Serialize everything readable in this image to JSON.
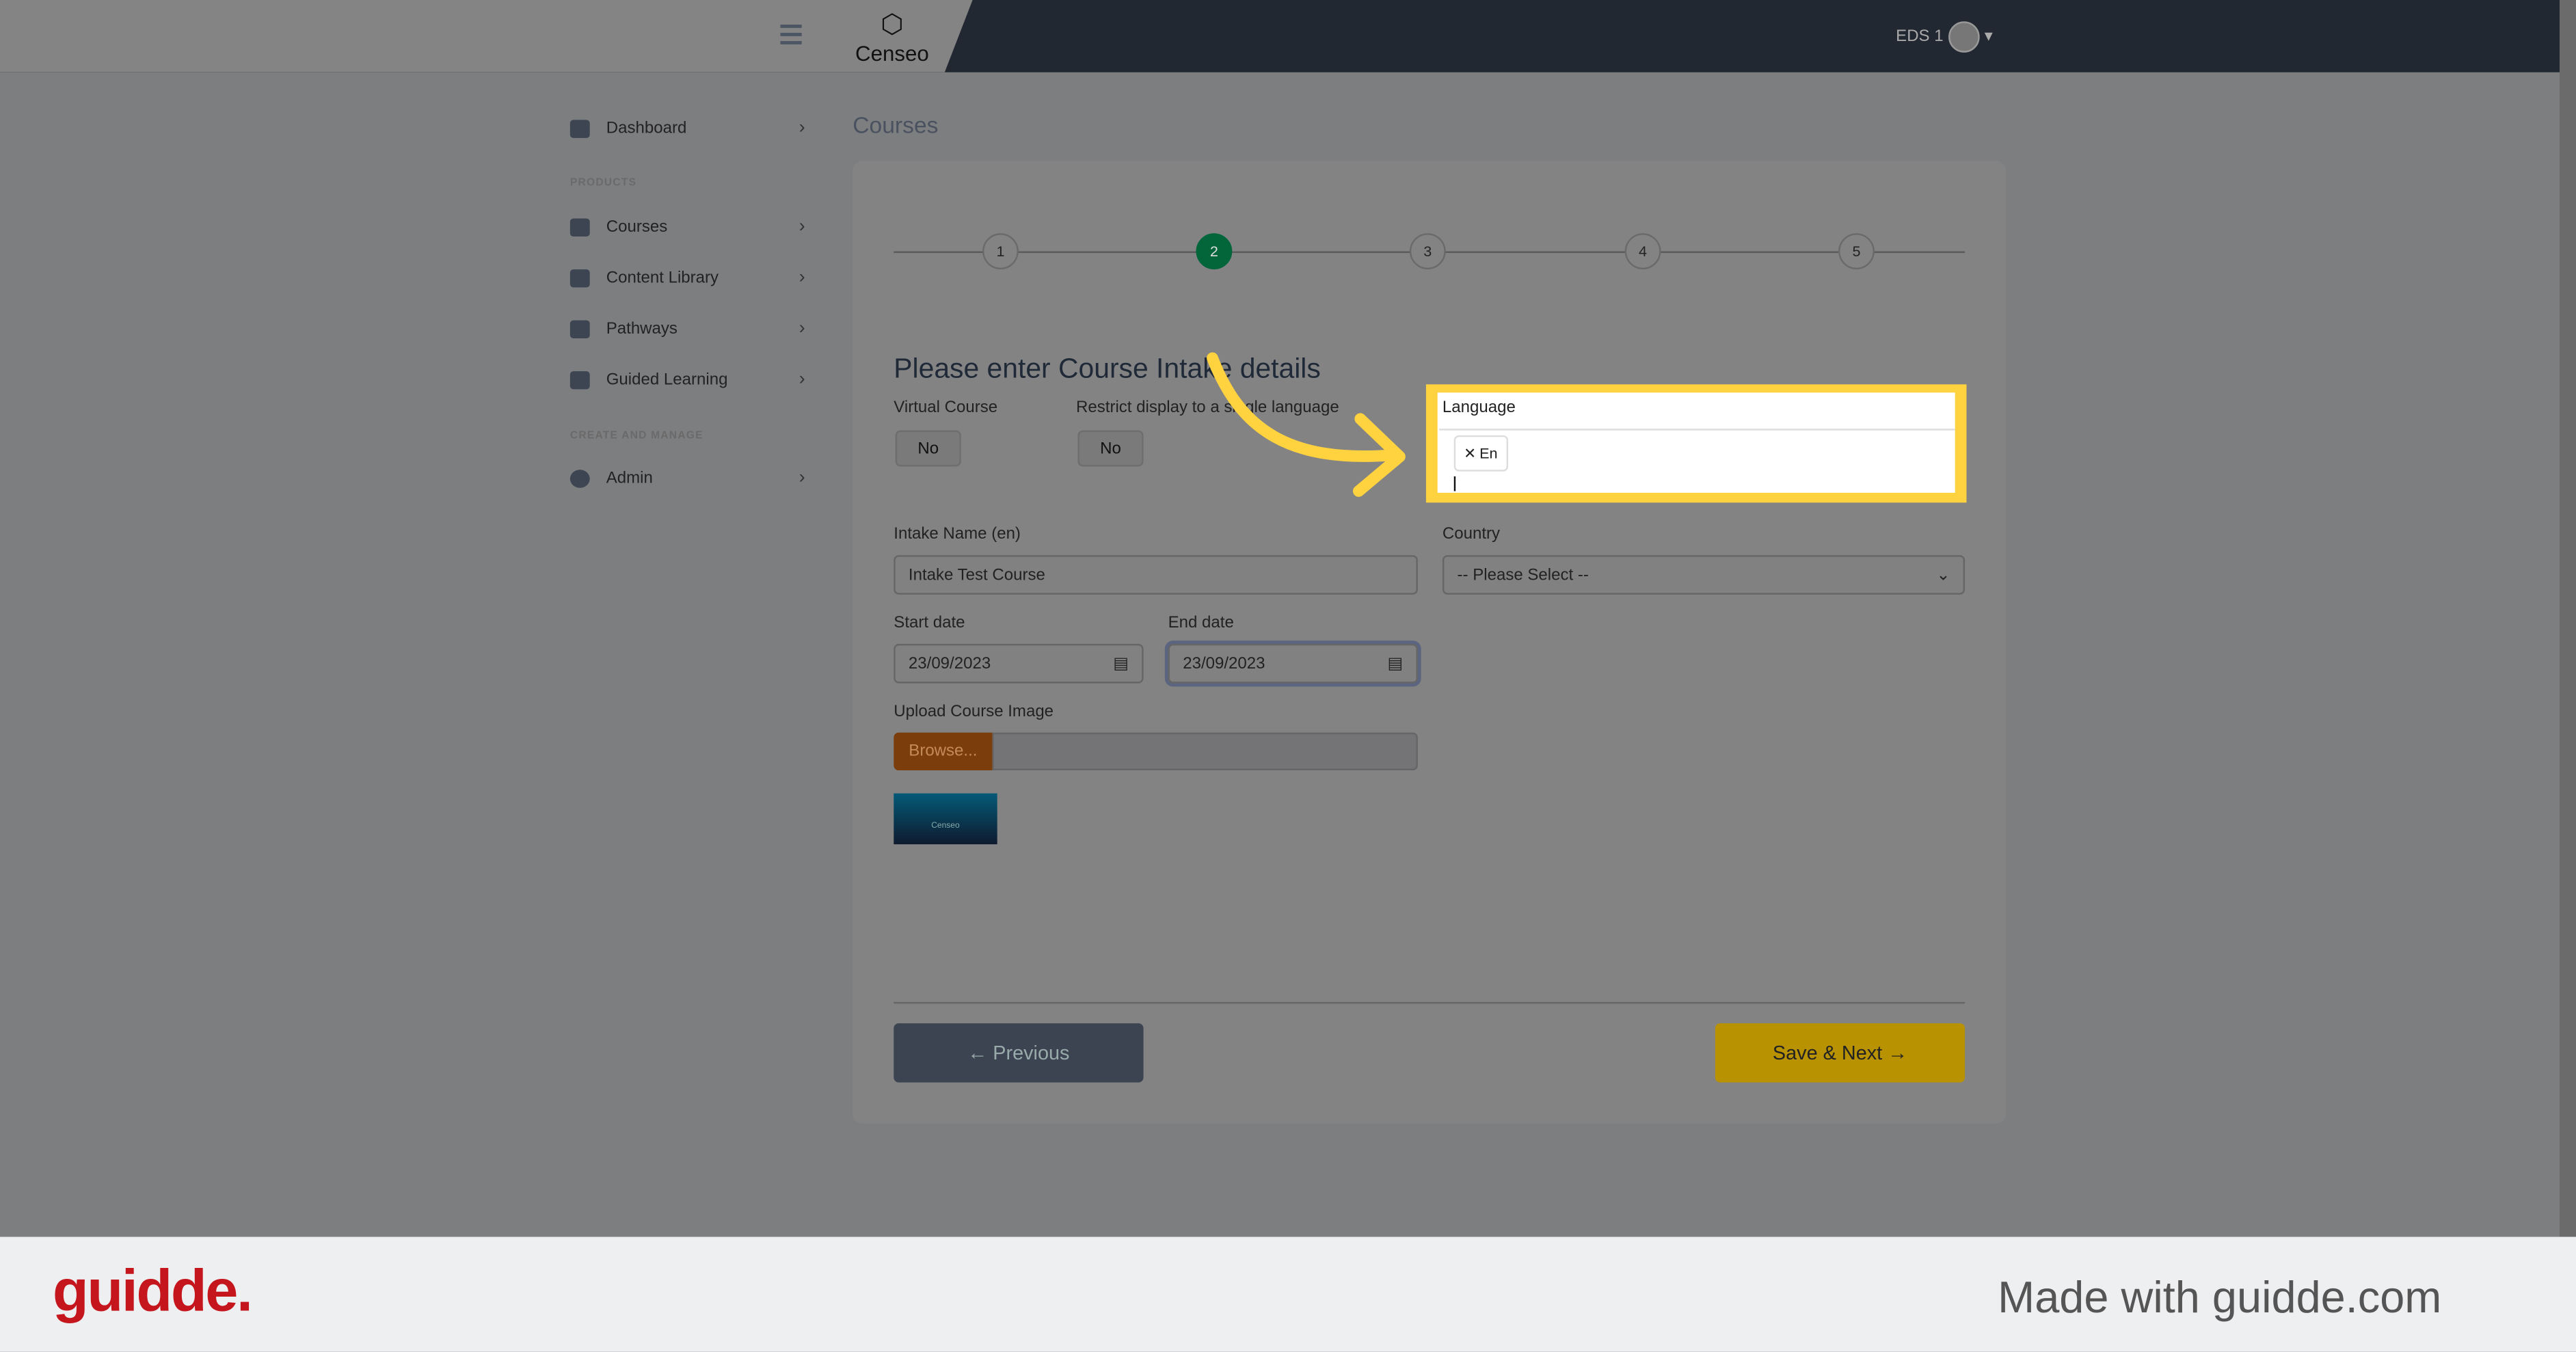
{
  "header": {
    "logo_text": "Censeo",
    "user_label": "EDS 1"
  },
  "sidebar": {
    "items": [
      {
        "label": "Dashboard"
      },
      {
        "label": "Courses"
      },
      {
        "label": "Content Library"
      },
      {
        "label": "Pathways"
      },
      {
        "label": "Guided Learning"
      },
      {
        "label": "Admin"
      }
    ],
    "section_products": "PRODUCTS",
    "section_create": "CREATE AND MANAGE"
  },
  "page": {
    "title": "Courses"
  },
  "steps": [
    "1",
    "2",
    "3",
    "4",
    "5"
  ],
  "active_step": 2,
  "form": {
    "title": "Please enter Course Intake details",
    "virtual_label": "Virtual Course",
    "virtual_value": "No",
    "restrict_label": "Restrict display to a single language",
    "restrict_value": "No",
    "language_label": "Language",
    "language_chip": "En",
    "intake_name_label": "Intake Name (en)",
    "intake_name_value": "Intake Test Course",
    "country_label": "Country",
    "country_value": "-- Please Select --",
    "start_label": "Start date",
    "start_value": "23/09/2023",
    "end_label": "End date",
    "end_value": "23/09/2023",
    "upload_label": "Upload Course Image",
    "browse_label": "Browse...",
    "thumb_text": "Censeo"
  },
  "buttons": {
    "previous": "← Previous",
    "next": "Save & Next →"
  },
  "footer": {
    "logo": "guidde.",
    "made_with": "Made with guidde.com"
  },
  "colors": {
    "highlight": "#ffd23f",
    "active_step": "#03663b",
    "next_button": "#b89200",
    "brand_red": "#c4161c"
  }
}
